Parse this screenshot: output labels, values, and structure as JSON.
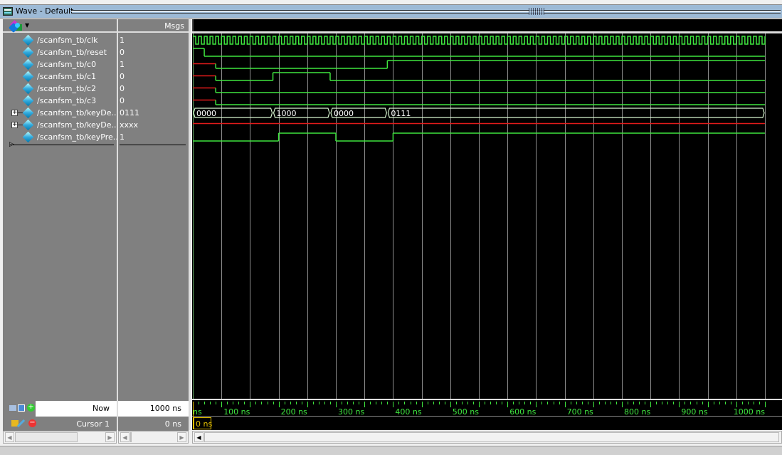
{
  "window": {
    "title": "Wave - Default"
  },
  "headers": {
    "msgs": "Msgs"
  },
  "signals": [
    {
      "name": "/scanfsm_tb/clk",
      "value": "1",
      "expandable": false
    },
    {
      "name": "/scanfsm_tb/reset",
      "value": "0",
      "expandable": false
    },
    {
      "name": "/scanfsm_tb/c0",
      "value": "1",
      "expandable": false
    },
    {
      "name": "/scanfsm_tb/c1",
      "value": "0",
      "expandable": false
    },
    {
      "name": "/scanfsm_tb/c2",
      "value": "0",
      "expandable": false
    },
    {
      "name": "/scanfsm_tb/c3",
      "value": "0",
      "expandable": false
    },
    {
      "name": "/scanfsm_tb/keyDe...",
      "value": "0111",
      "expandable": true
    },
    {
      "name": "/scanfsm_tb/keyDe...",
      "value": "xxxx",
      "expandable": true
    },
    {
      "name": "/scanfsm_tb/keyPre...",
      "value": "1",
      "expandable": false
    }
  ],
  "status": {
    "now_label": "Now",
    "now_value": "1000 ns",
    "cursor_label": "Cursor 1",
    "cursor_value": "0 ns",
    "cursor_marker": "0 ns"
  },
  "timeline": {
    "unit": "ns",
    "start": 0,
    "end": 1000,
    "ticks": [
      "ns",
      "100 ns",
      "200 ns",
      "300 ns",
      "400 ns",
      "500 ns",
      "600 ns",
      "700 ns",
      "800 ns",
      "900 ns",
      "1000 ns"
    ]
  },
  "colors": {
    "wave_green": "#3fe63f",
    "wave_red": "#e21b1b",
    "bus_white": "#d8f7d0",
    "grid": "#8c8c8c",
    "cursor_yellow": "#e6c200"
  },
  "waves": {
    "clk": {
      "type": "clock",
      "period_ns": 10
    },
    "reset": {
      "type": "bit",
      "edges": [
        [
          0,
          1
        ],
        [
          20,
          0
        ]
      ]
    },
    "c0": {
      "type": "bit",
      "edges": [
        [
          0,
          "x"
        ],
        [
          40,
          0
        ],
        [
          340,
          1
        ]
      ]
    },
    "c1": {
      "type": "bit",
      "edges": [
        [
          0,
          "x"
        ],
        [
          40,
          0
        ],
        [
          140,
          1
        ],
        [
          240,
          0
        ]
      ]
    },
    "c2": {
      "type": "bit",
      "edges": [
        [
          0,
          "x"
        ],
        [
          40,
          0
        ]
      ]
    },
    "c3": {
      "type": "bit",
      "edges": [
        [
          0,
          "x"
        ],
        [
          40,
          0
        ]
      ]
    },
    "keyDecoded": {
      "type": "bus",
      "segments": [
        [
          0,
          "0000"
        ],
        [
          140,
          "1000"
        ],
        [
          240,
          "0000"
        ],
        [
          340,
          "0111"
        ]
      ]
    },
    "keyDetect": {
      "type": "busx"
    },
    "keyPressed": {
      "type": "bit",
      "edges": [
        [
          0,
          0
        ],
        [
          150,
          1
        ],
        [
          250,
          0
        ],
        [
          350,
          1
        ]
      ]
    }
  }
}
